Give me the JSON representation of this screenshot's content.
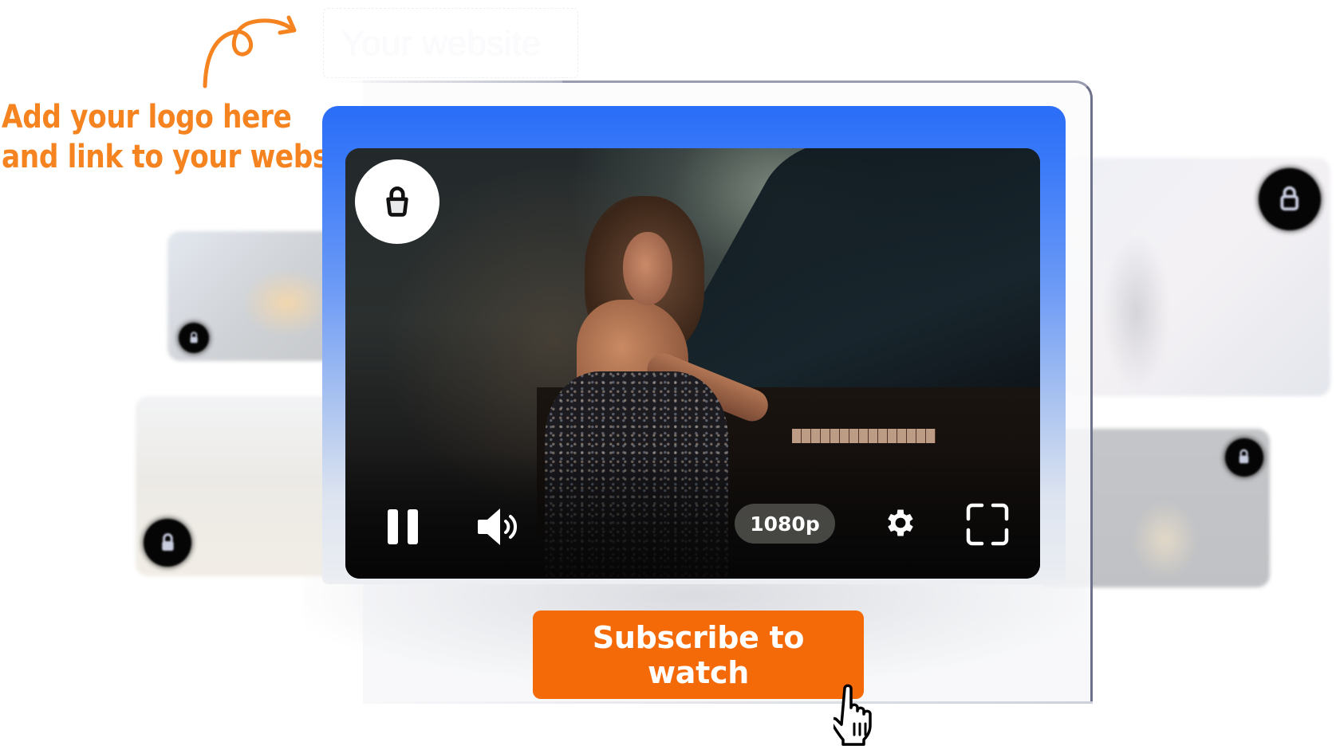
{
  "annotation": {
    "line1": "Add your logo here",
    "line2": "and link to your website",
    "color": "#f5831f"
  },
  "logo_placeholder": {
    "text": "Your website"
  },
  "player": {
    "accent_color": "#2a6df7",
    "lock_icon": "lock-icon",
    "controls": {
      "pause_icon": "pause-icon",
      "volume_icon": "volume-icon",
      "quality_label": "1080p",
      "settings_icon": "gear-icon",
      "fullscreen_icon": "fullscreen-icon"
    },
    "video_description": "Woman in sequined dress seated at a grand piano"
  },
  "cta": {
    "label": "Subscribe to watch",
    "color": "#f56a08"
  },
  "side_thumbnails": [
    {
      "position": "left-top",
      "locked": true
    },
    {
      "position": "left-bottom",
      "locked": true
    },
    {
      "position": "right-top",
      "locked": true
    },
    {
      "position": "right-bottom",
      "locked": true
    }
  ]
}
